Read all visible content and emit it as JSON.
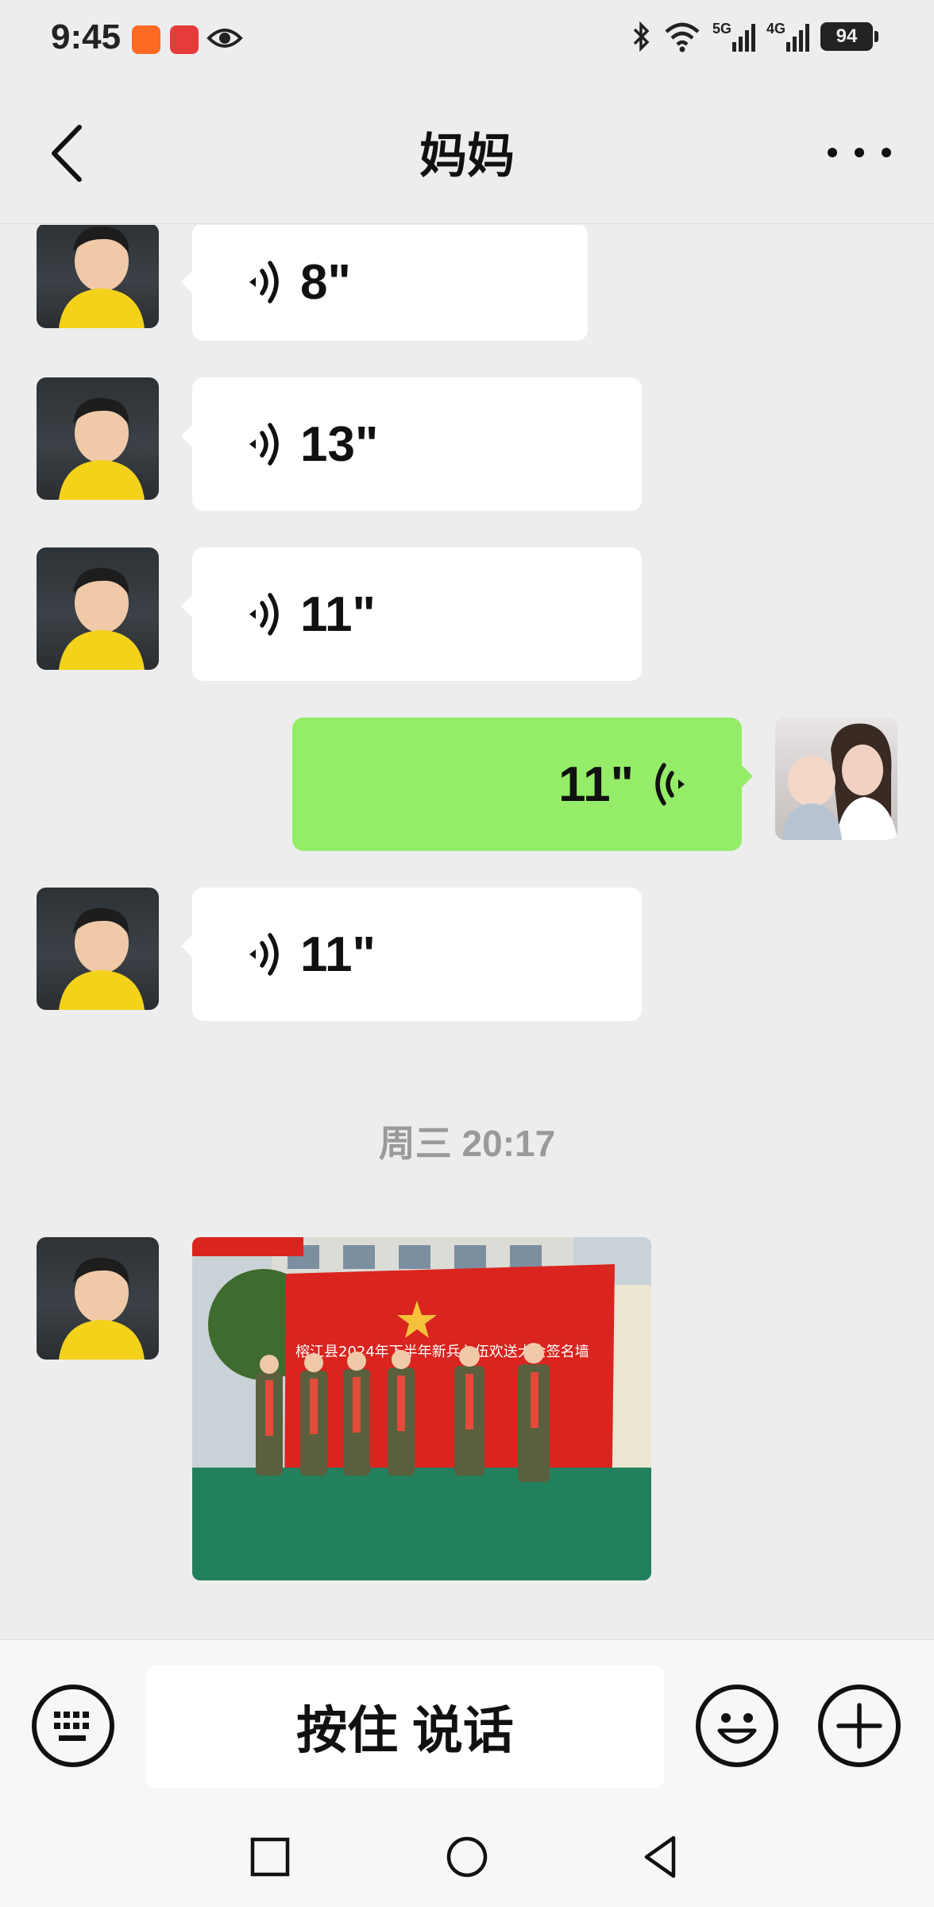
{
  "status_bar": {
    "time": "9:45",
    "battery": "94",
    "net_5g": "5G",
    "net_4g": "4G"
  },
  "header": {
    "title": "妈妈"
  },
  "messages": [
    {
      "direction": "in",
      "type": "voice",
      "duration": "8\""
    },
    {
      "direction": "in",
      "type": "voice",
      "duration": "13\""
    },
    {
      "direction": "in",
      "type": "voice",
      "duration": "11\""
    },
    {
      "direction": "out",
      "type": "voice",
      "duration": "11\""
    },
    {
      "direction": "in",
      "type": "voice",
      "duration": "11\""
    }
  ],
  "time_divider": "周三 20:17",
  "photo_message": {
    "banner_text": "榕江县2024年下半年新兵入伍欢送大会签名墙"
  },
  "input_bar": {
    "talk_label": "按住 说话"
  },
  "colors": {
    "background": "#ededed",
    "incoming_bubble": "#ffffff",
    "outgoing_bubble": "#95ec69",
    "banner_red": "#d9241f"
  }
}
